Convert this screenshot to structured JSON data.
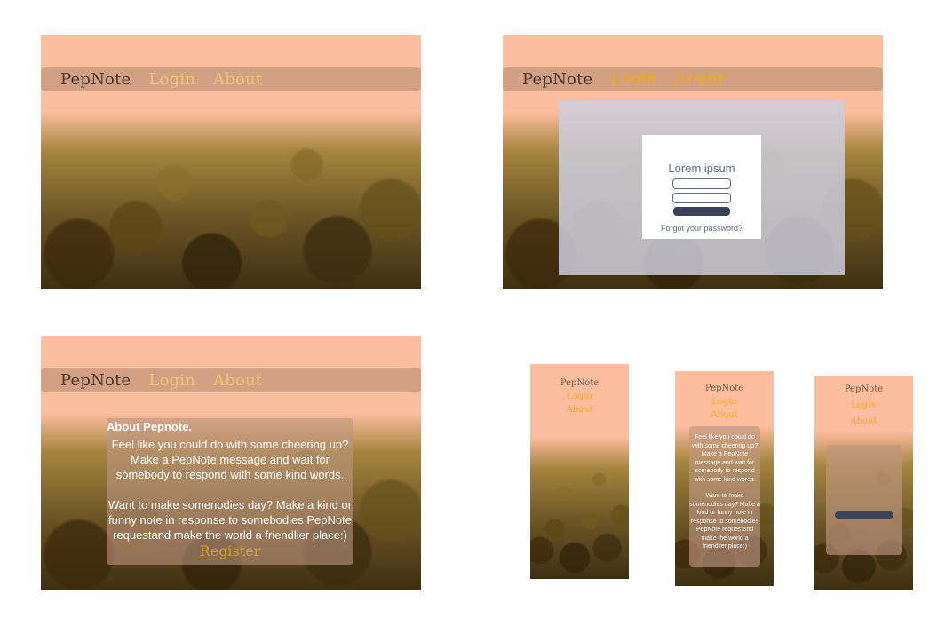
{
  "nav": {
    "brand": "PepNote",
    "login": "Login",
    "about": "About"
  },
  "login": {
    "title": "Lorem ipsum",
    "forgot": "Forgot your password?"
  },
  "about": {
    "title": "About Pepnote.",
    "p1": "Feel like you could do with some cheering up? Make a PepNote message and wait for somebody to respond with some kind words.",
    "p2": "Want to make somenodies day? Make a kind or funny note in response to somebodies PepNote requestand make the world a friendlier place:)",
    "register": "Register"
  },
  "colors": {
    "background": "#fdbd9f",
    "navbar": "#d4a084",
    "brand": "#4a342b",
    "link": "#eac773",
    "link_active": "#f5a623",
    "overlay": "#cecedc"
  },
  "icons": [
    "crowd-photo"
  ]
}
